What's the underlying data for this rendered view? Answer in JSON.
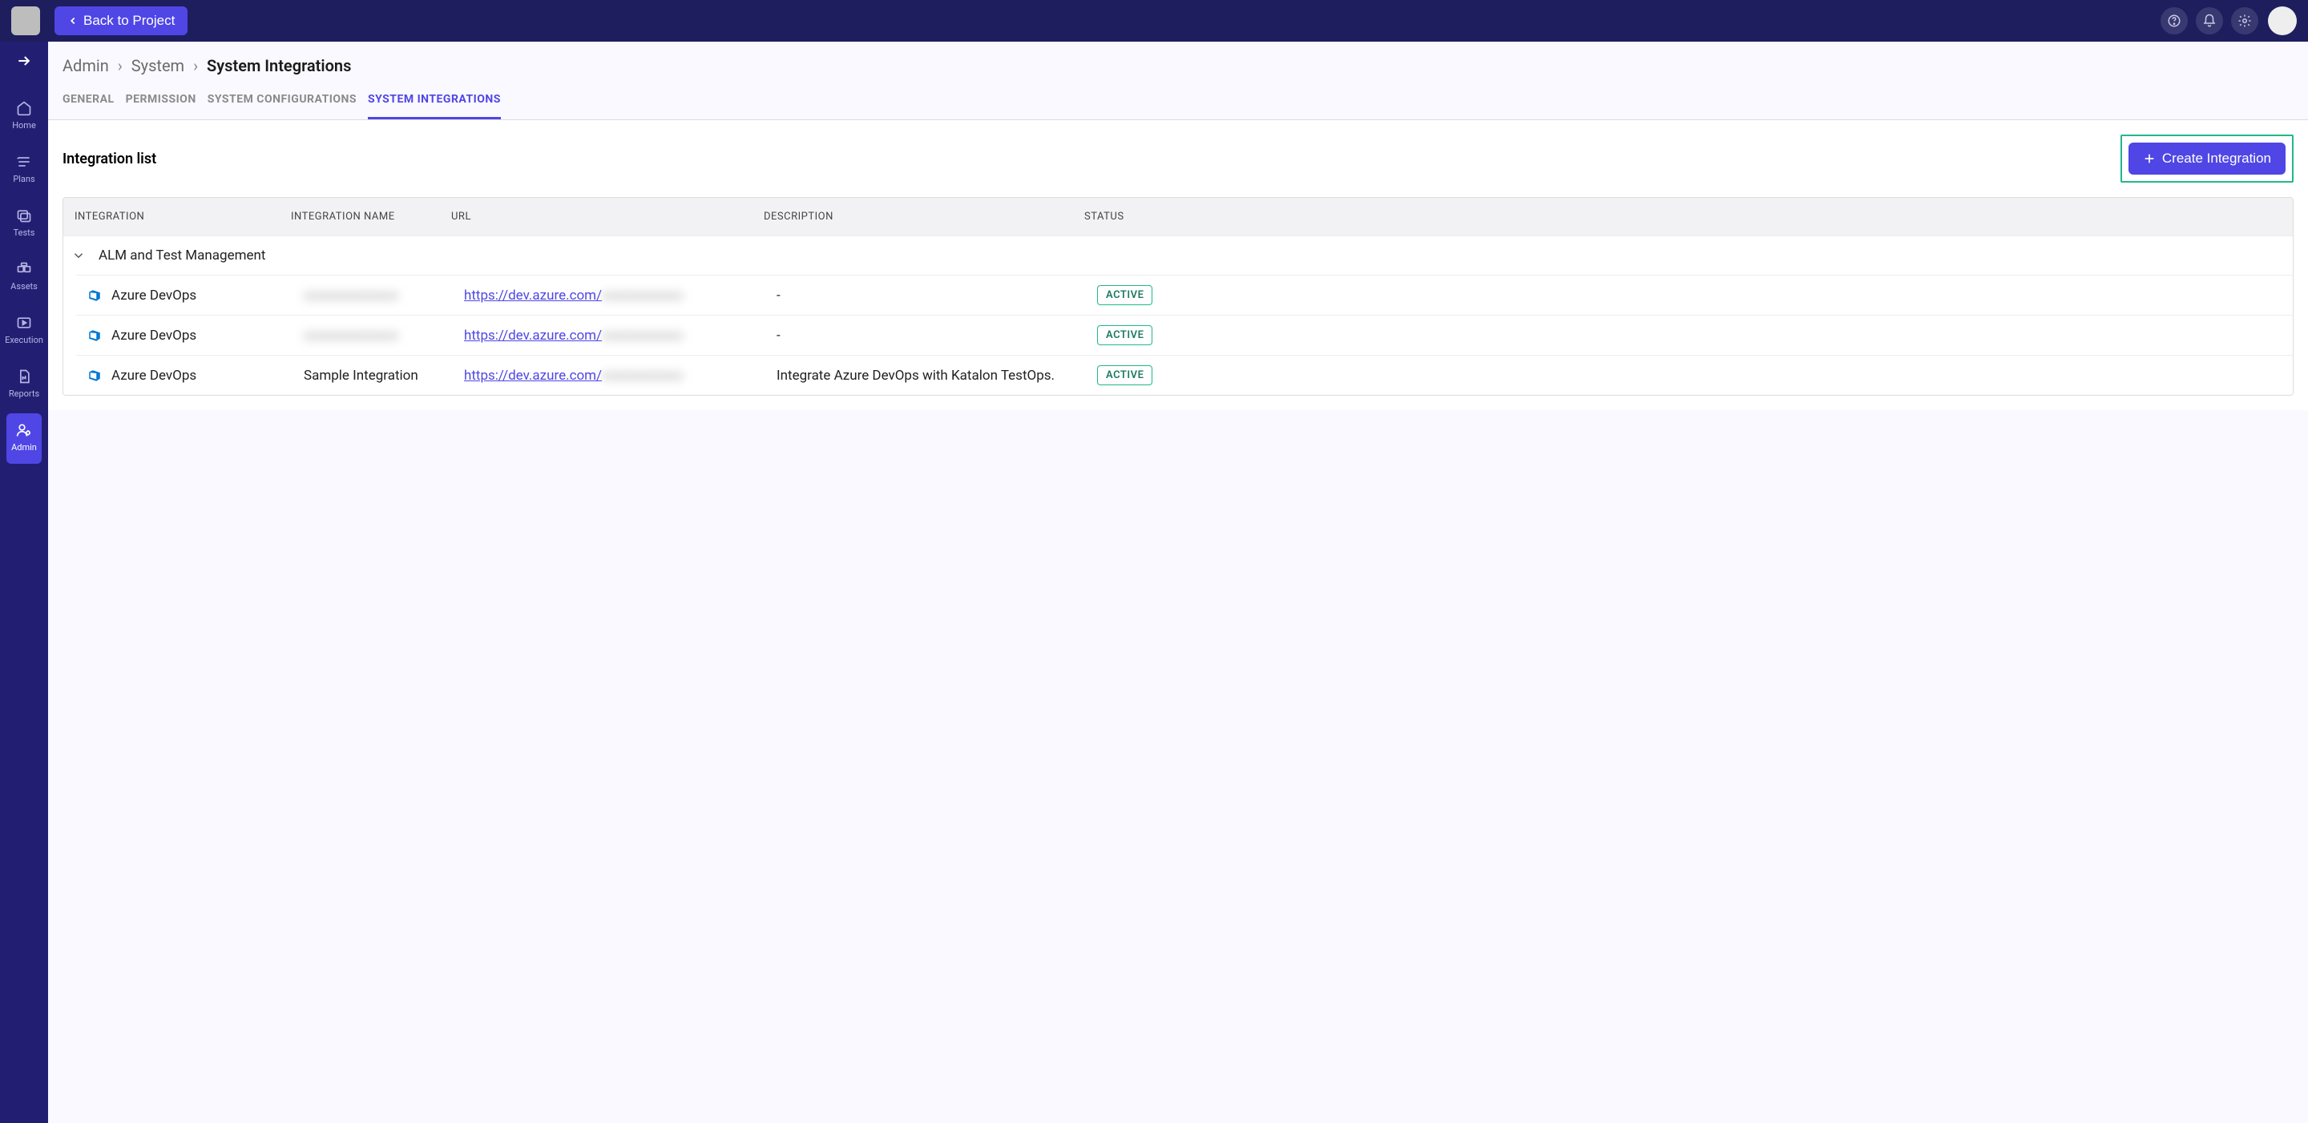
{
  "header": {
    "back_label": "Back to Project"
  },
  "sidebar": {
    "items": [
      {
        "label": "Home"
      },
      {
        "label": "Plans"
      },
      {
        "label": "Tests"
      },
      {
        "label": "Assets"
      },
      {
        "label": "Execution"
      },
      {
        "label": "Reports"
      },
      {
        "label": "Admin"
      }
    ],
    "active": 6
  },
  "breadcrumb": {
    "a": "Admin",
    "b": "System",
    "c": "System Integrations"
  },
  "tabs": [
    {
      "label": "GENERAL"
    },
    {
      "label": "PERMISSION"
    },
    {
      "label": "SYSTEM CONFIGURATIONS"
    },
    {
      "label": "SYSTEM INTEGRATIONS"
    }
  ],
  "active_tab": 3,
  "list_title": "Integration list",
  "create_label": "Create Integration",
  "columns": {
    "c0": "INTEGRATION",
    "c1": "INTEGRATION NAME",
    "c2": "URL",
    "c3": "DESCRIPTION",
    "c4": "STATUS"
  },
  "group_label": "ALM and Test Management",
  "rows": [
    {
      "integration": "Azure DevOps",
      "name": "",
      "name_blur": true,
      "url": "https://dev.azure.com/",
      "url_extra_blur": true,
      "desc": "-",
      "status": "ACTIVE"
    },
    {
      "integration": "Azure DevOps",
      "name": "",
      "name_blur": true,
      "url": "https://dev.azure.com/",
      "url_extra_blur": true,
      "desc": "-",
      "status": "ACTIVE"
    },
    {
      "integration": "Azure DevOps",
      "name": "Sample Integration",
      "name_blur": false,
      "url": "https://dev.azure.com/",
      "url_extra_blur": true,
      "desc": "Integrate Azure DevOps with Katalon TestOps.",
      "status": "ACTIVE"
    }
  ]
}
